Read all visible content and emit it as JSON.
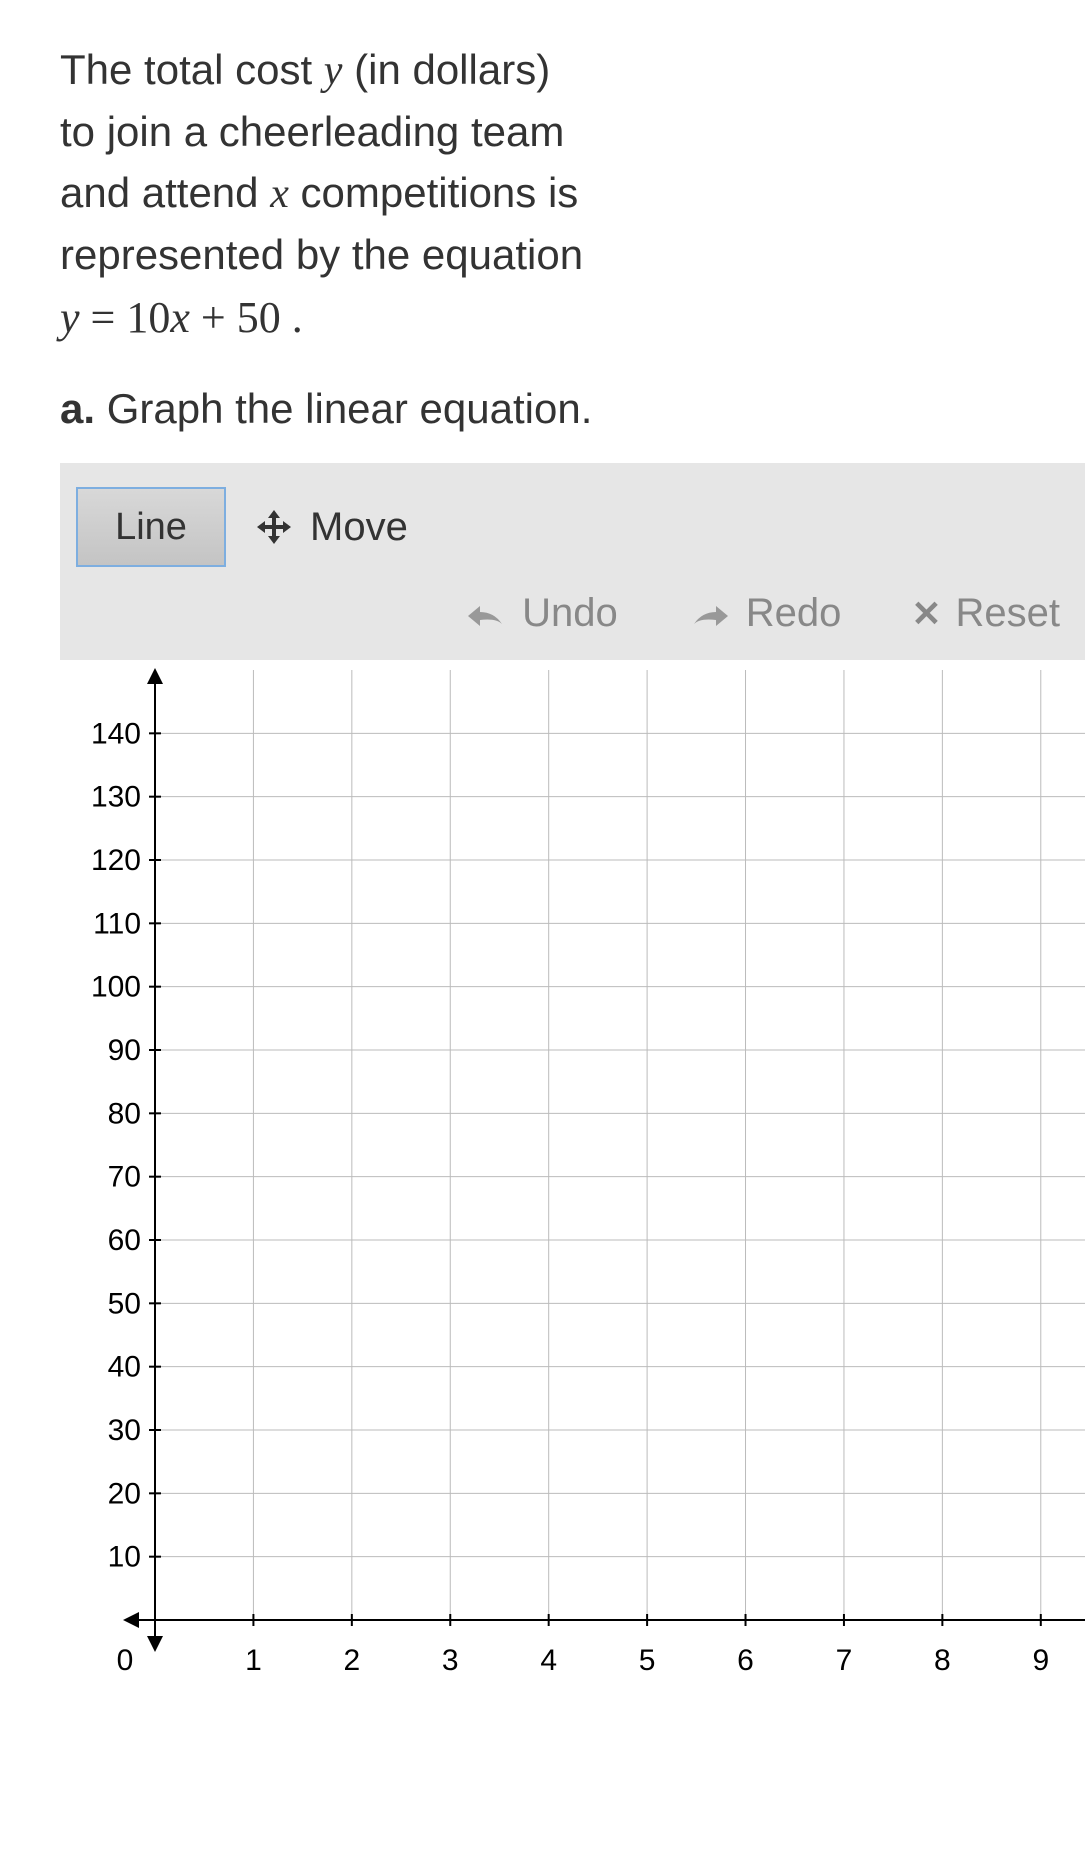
{
  "problem": {
    "line1": "The total cost ",
    "var1": "y",
    "line1b": " (in dollars)",
    "line2": "to join a cheerleading team",
    "line3a": "and attend ",
    "var2": "x",
    "line3b": " competitions is",
    "line4": "represented by the equation",
    "equation": "y = 10x + 50 ."
  },
  "part_a": {
    "label": "a.",
    "text": " Graph the linear equation."
  },
  "toolbar": {
    "line": "Line",
    "move": "Move",
    "undo": "Undo",
    "redo": "Redo",
    "reset": "Reset"
  },
  "chart_data": {
    "type": "line",
    "x_ticks": [
      0,
      1,
      2,
      3,
      4,
      5,
      6,
      7,
      8,
      9
    ],
    "y_ticks": [
      10,
      20,
      30,
      40,
      50,
      60,
      70,
      80,
      90,
      100,
      110,
      120,
      130,
      140
    ],
    "xlim": [
      0,
      9.5
    ],
    "ylim": [
      0,
      150
    ],
    "grid": true,
    "series": []
  }
}
